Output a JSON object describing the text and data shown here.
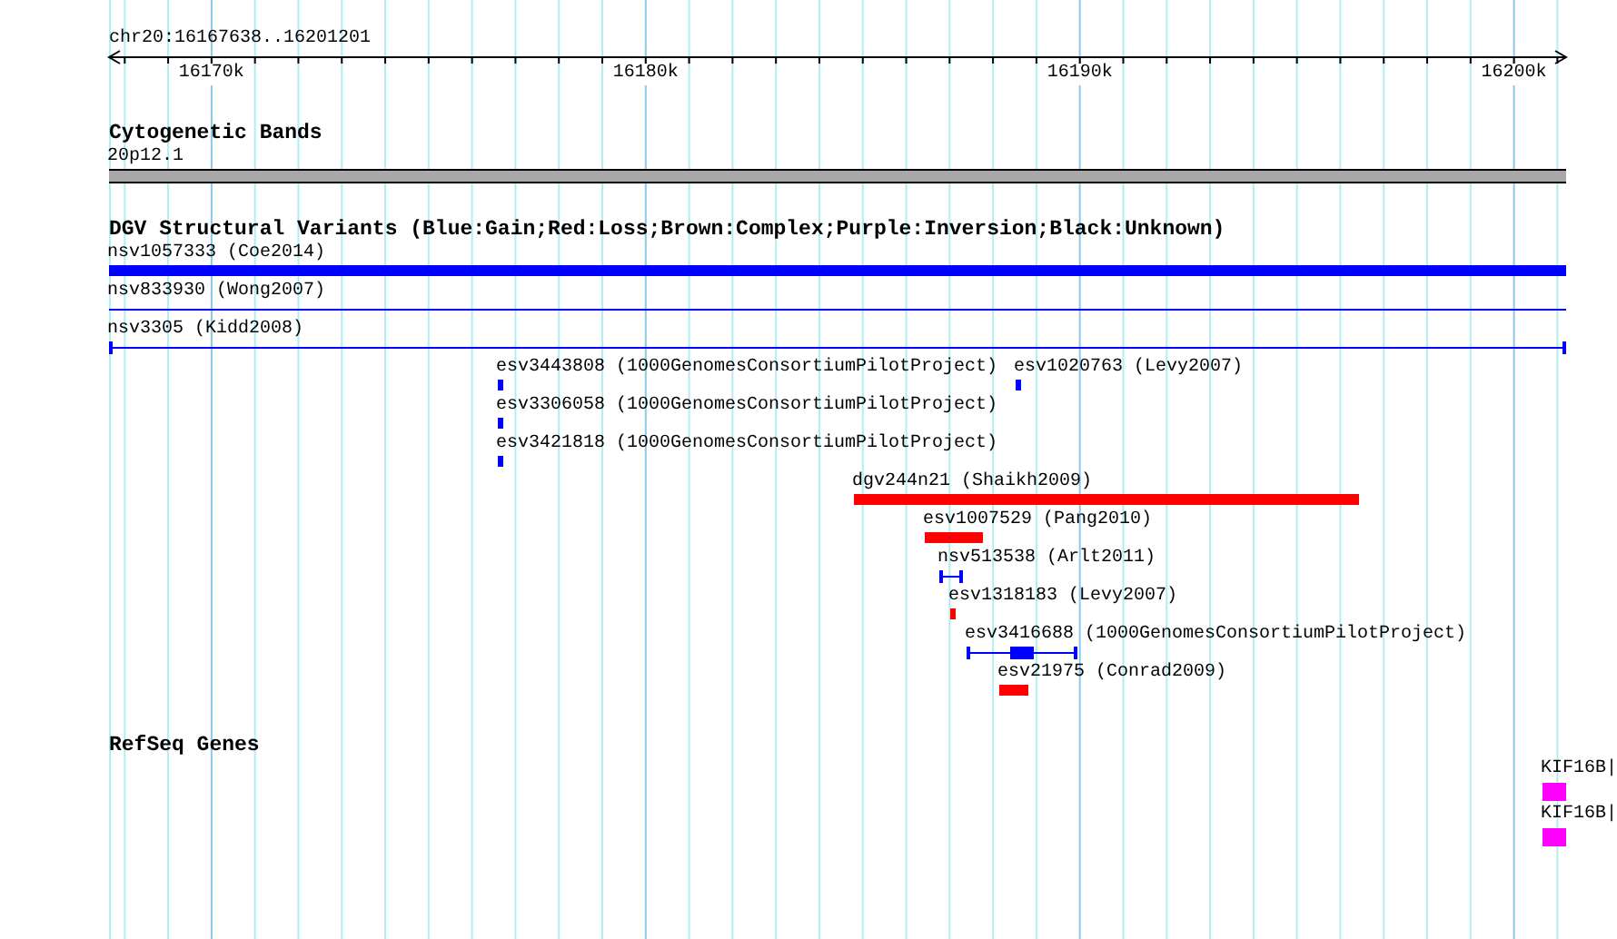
{
  "ruler": {
    "location": "chr20:16167638..16201201",
    "ticks": [
      {
        "label": "16170k"
      },
      {
        "label": "16180k"
      },
      {
        "label": "16190k"
      },
      {
        "label": "16200k"
      }
    ]
  },
  "tracks": [
    {
      "kind": "bands",
      "title": "Cytogenetic Bands",
      "features": [
        {
          "label": "20p12.1"
        }
      ]
    },
    {
      "kind": "variants",
      "title": "DGV Structural Variants (Blue:Gain;Red:Loss;Brown:Complex;Purple:Inversion;Black:Unknown)",
      "features": [
        {
          "label": "nsv1057333 (Coe2014)",
          "kind": "bar",
          "color": "#0000ff"
        },
        {
          "label": "nsv833930 (Wong2007)",
          "kind": "line",
          "color": "#0000ff"
        },
        {
          "label": "nsv3305 (Kidd2008)",
          "kind": "capped",
          "color": "#0000ff"
        },
        {
          "label": "esv3443808 (1000GenomesConsortiumPilotProject)",
          "kind": "bar",
          "color": "#0000ff"
        },
        {
          "label": "esv1020763 (Levy2007)",
          "kind": "bar",
          "color": "#0000ff"
        },
        {
          "label": "esv3306058 (1000GenomesConsortiumPilotProject)",
          "kind": "bar",
          "color": "#0000ff"
        },
        {
          "label": "esv3421818 (1000GenomesConsortiumPilotProject)",
          "kind": "bar",
          "color": "#0000ff"
        },
        {
          "label": "dgv244n21 (Shaikh2009)",
          "kind": "bar",
          "color": "#ff0000"
        },
        {
          "label": "esv1007529 (Pang2010)",
          "kind": "bar",
          "color": "#ff0000"
        },
        {
          "label": "nsv513538 (Arlt2011)",
          "kind": "capped",
          "color": "#0000ff"
        },
        {
          "label": "esv1318183 (Levy2007)",
          "kind": "bar",
          "color": "#ff0000"
        },
        {
          "label": "esv3416688 (1000GenomesConsortiumPilotProject)",
          "kind": "capped-thick",
          "color": "#0000ff"
        },
        {
          "label": "esv21975 (Conrad2009)",
          "kind": "bar",
          "color": "#ff0000"
        }
      ]
    },
    {
      "kind": "genes",
      "title": "RefSeq Genes",
      "features": [
        {
          "label": "KIF16B|",
          "color": "#ff00ff"
        },
        {
          "label": "KIF16B|",
          "color": "#ff00ff"
        }
      ]
    }
  ]
}
